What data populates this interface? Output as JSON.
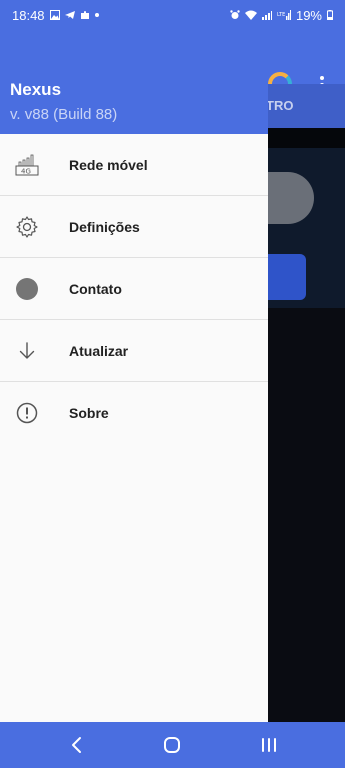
{
  "status_bar": {
    "time": "18:48",
    "battery": "19%",
    "icons": [
      "image-icon",
      "telegram-icon",
      "puzzle-icon",
      "dot-icon",
      "alarm-icon",
      "wifi-icon",
      "signal-icon",
      "lte-signal-icon",
      "battery-icon"
    ]
  },
  "background_app": {
    "tab_label": "TRO"
  },
  "drawer": {
    "app_name": "Nexus",
    "version": "v. v88 (Build 88)",
    "items": [
      {
        "label": "Rede móvel",
        "icon": "mobile-network-4g-icon"
      },
      {
        "label": "Definições",
        "icon": "gear-icon"
      },
      {
        "label": "Contato",
        "icon": "contact-circle-icon"
      },
      {
        "label": "Atualizar",
        "icon": "arrow-down-icon"
      },
      {
        "label": "Sobre",
        "icon": "info-exclamation-icon"
      }
    ]
  },
  "navbar": {
    "buttons": [
      "back-icon",
      "home-icon",
      "recents-icon"
    ]
  },
  "colors": {
    "accent": "#4a6ee0",
    "drawer_bg": "#fafafa",
    "text": "#212121"
  }
}
